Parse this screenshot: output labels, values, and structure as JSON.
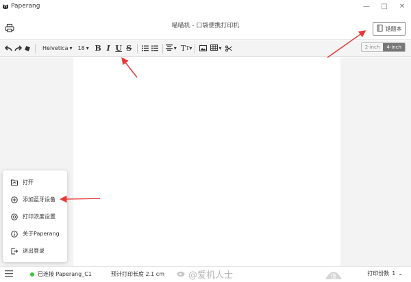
{
  "window": {
    "app_name": "Paperang",
    "minimize": "—",
    "maximize": "□",
    "close": "✕"
  },
  "header": {
    "title": "喵喵机 - 口袋便携打印机",
    "wrongbook_label": "错题本"
  },
  "toolbar": {
    "font_family": "Helvetica",
    "font_size": "18",
    "bold": "B",
    "italic": "I",
    "underline": "U",
    "strike": "S",
    "text_size_icon": "T",
    "width_options": [
      "2-inch",
      "4-inch"
    ],
    "selected_width": "4-inch"
  },
  "menu": {
    "items": [
      {
        "label": "打开",
        "icon": "folder-icon"
      },
      {
        "label": "添加蓝牙设备",
        "icon": "add-circle-icon"
      },
      {
        "label": "打印浓度设置",
        "icon": "target-icon"
      },
      {
        "label": "关于Paperang",
        "icon": "info-icon"
      },
      {
        "label": "退出登录",
        "icon": "logout-icon"
      }
    ]
  },
  "status": {
    "connection": "已连接 Paperang_C1",
    "print_length": "预计打印长度 2.1 cm",
    "copies_label": "打印份数",
    "copies_value": "1",
    "watermark": "@爱机人士"
  },
  "colors": {
    "accent_red": "#e53935",
    "connected_green": "#3ec13e",
    "selected_segment": "#777777"
  }
}
